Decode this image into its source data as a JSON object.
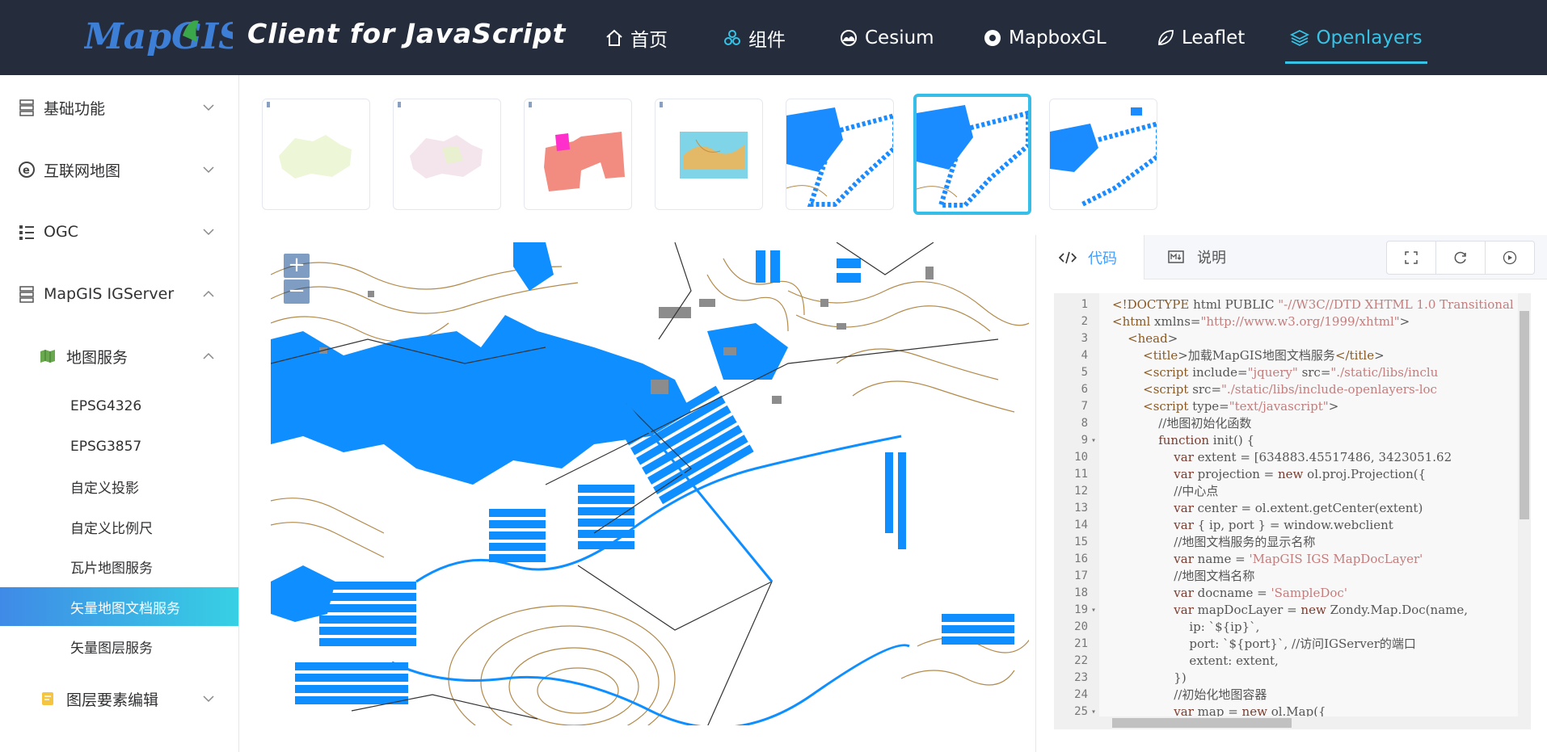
{
  "header": {
    "logo_text": "MapGIS",
    "brand": "Client for JavaScript",
    "nav": [
      {
        "label": "首页",
        "icon": "home-icon"
      },
      {
        "label": "组件",
        "icon": "components-icon"
      },
      {
        "label": "Cesium",
        "icon": "cesium-icon"
      },
      {
        "label": "MapboxGL",
        "icon": "mapbox-icon"
      },
      {
        "label": "Leaflet",
        "icon": "leaflet-icon"
      },
      {
        "label": "Openlayers",
        "icon": "layers-icon",
        "active": true
      }
    ]
  },
  "sidebar": {
    "groups": [
      {
        "label": "基础功能",
        "icon": "server-icon",
        "expanded": false
      },
      {
        "label": "互联网地图",
        "icon": "ie-icon",
        "expanded": false
      },
      {
        "label": "OGC",
        "icon": "list-icon",
        "expanded": false
      },
      {
        "label": "MapGIS IGServer",
        "icon": "server-icon",
        "expanded": true
      }
    ],
    "subgroup": {
      "label": "地图服务",
      "icon": "map-book-icon",
      "expanded": true
    },
    "leaves": [
      "EPSG4326",
      "EPSG3857",
      "自定义投影",
      "自定义比例尺",
      "瓦片地图服务",
      "矢量地图文档服务",
      "矢量图层服务"
    ],
    "active_leaf": "矢量地图文档服务",
    "subgroup2": {
      "label": "图层要素编辑",
      "icon": "edit-icon",
      "expanded": false
    }
  },
  "thumbnails": {
    "count": 7,
    "selected_index": 5
  },
  "map": {
    "zoom_in": "+",
    "zoom_out": "−",
    "colors": {
      "water": "#0f8fff",
      "contour": "#b28a4a",
      "building": "#8c8c8c",
      "road": "#333333"
    }
  },
  "code_panel": {
    "tabs": [
      {
        "label": "代码",
        "icon": "code-icon",
        "active": true
      },
      {
        "label": "说明",
        "icon": "markdown-icon",
        "active": false
      }
    ],
    "tools": [
      "fullscreen-icon",
      "refresh-icon",
      "run-icon"
    ],
    "lines": [
      "<!DOCTYPE html PUBLIC \"-//W3C//DTD XHTML 1.0 Transitional",
      "<html xmlns=\"http://www.w3.org/1999/xhtml\">",
      "    <head>",
      "        <title>加载MapGIS地图文档服务</title>",
      "        <script include=\"jquery\" src=\"./static/libs/inclu",
      "        <script src=\"./static/libs/include-openlayers-loc",
      "        <script type=\"text/javascript\">",
      "            //地图初始化函数",
      "            function init() {",
      "                var extent = [634883.45517486, 3423051.62",
      "                var projection = new ol.proj.Projection({",
      "                //中心点",
      "                var center = ol.extent.getCenter(extent)",
      "                var { ip, port } = window.webclient",
      "                //地图文档服务的显示名称",
      "                var name = 'MapGIS IGS MapDocLayer'",
      "                //地图文档名称",
      "                var docname = 'SampleDoc'",
      "                var mapDocLayer = new Zondy.Map.Doc(name,",
      "                    ip: `${ip}`,",
      "                    port: `${port}`, //访问IGServer的端口",
      "                    extent: extent,",
      "                })",
      "                //初始化地图容器",
      "                var map = new ol.Map({"
    ],
    "fold_lines": [
      9,
      19,
      25
    ]
  }
}
